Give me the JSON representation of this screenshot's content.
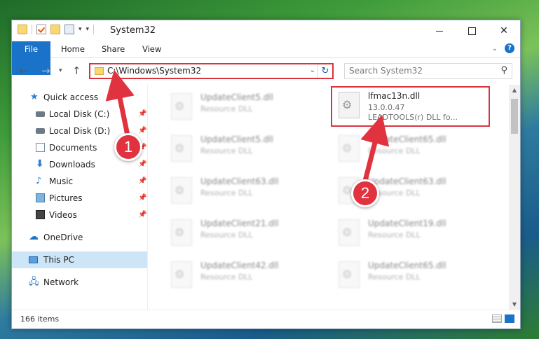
{
  "window": {
    "title": "System32",
    "controls": {
      "minimize": "",
      "maximize": "",
      "close": "✕"
    }
  },
  "ribbon": {
    "tabs": [
      "File",
      "Home",
      "Share",
      "View"
    ],
    "accent": "#1a73c9"
  },
  "navigation": {
    "address": "C:\\Windows\\System32",
    "search_placeholder": "Search System32"
  },
  "sidebar": {
    "items": [
      {
        "label": "Quick access",
        "icon": "star-icon"
      },
      {
        "label": "Local Disk (C:)",
        "icon": "drive-icon",
        "pinned": true
      },
      {
        "label": "Local Disk (D:)",
        "icon": "drive-icon",
        "pinned": true
      },
      {
        "label": "Documents",
        "icon": "document-icon",
        "pinned": true
      },
      {
        "label": "Downloads",
        "icon": "download-icon",
        "pinned": true
      },
      {
        "label": "Music",
        "icon": "music-icon",
        "pinned": true
      },
      {
        "label": "Pictures",
        "icon": "pictures-icon",
        "pinned": true
      },
      {
        "label": "Videos",
        "icon": "video-icon",
        "pinned": true
      },
      {
        "label": "OneDrive",
        "icon": "cloud-icon"
      },
      {
        "label": "This PC",
        "icon": "computer-icon",
        "selected": true
      },
      {
        "label": "Network",
        "icon": "network-icon"
      }
    ]
  },
  "files": {
    "left_column": [
      {
        "name": "UpdateClient5.dll",
        "type": "Resource DLL"
      },
      {
        "name": "UpdateClient5.dll",
        "type": "Resource DLL"
      },
      {
        "name": "UpdateClient63.dll",
        "type": "Resource DLL"
      },
      {
        "name": "UpdateClient21.dll",
        "type": "Resource DLL"
      },
      {
        "name": "UpdateClient42.dll",
        "type": "Resource DLL"
      }
    ],
    "right_column": [
      {
        "name": "lfmac13n.dll",
        "version": "13.0.0.47",
        "description": "LEADTOOLS(r) DLL fo..."
      },
      {
        "name": "UpdateClient65.dll",
        "type": "Resource DLL"
      },
      {
        "name": "UpdateClient63.dll",
        "type": "Resource DLL"
      },
      {
        "name": "UpdateClient19.dll",
        "type": "Resource DLL"
      },
      {
        "name": "UpdateClient65.dll",
        "type": "Resource DLL"
      }
    ]
  },
  "status": {
    "item_count": "166 items"
  },
  "callouts": {
    "step1": "1",
    "step2": "2",
    "color": "#e0333f"
  }
}
